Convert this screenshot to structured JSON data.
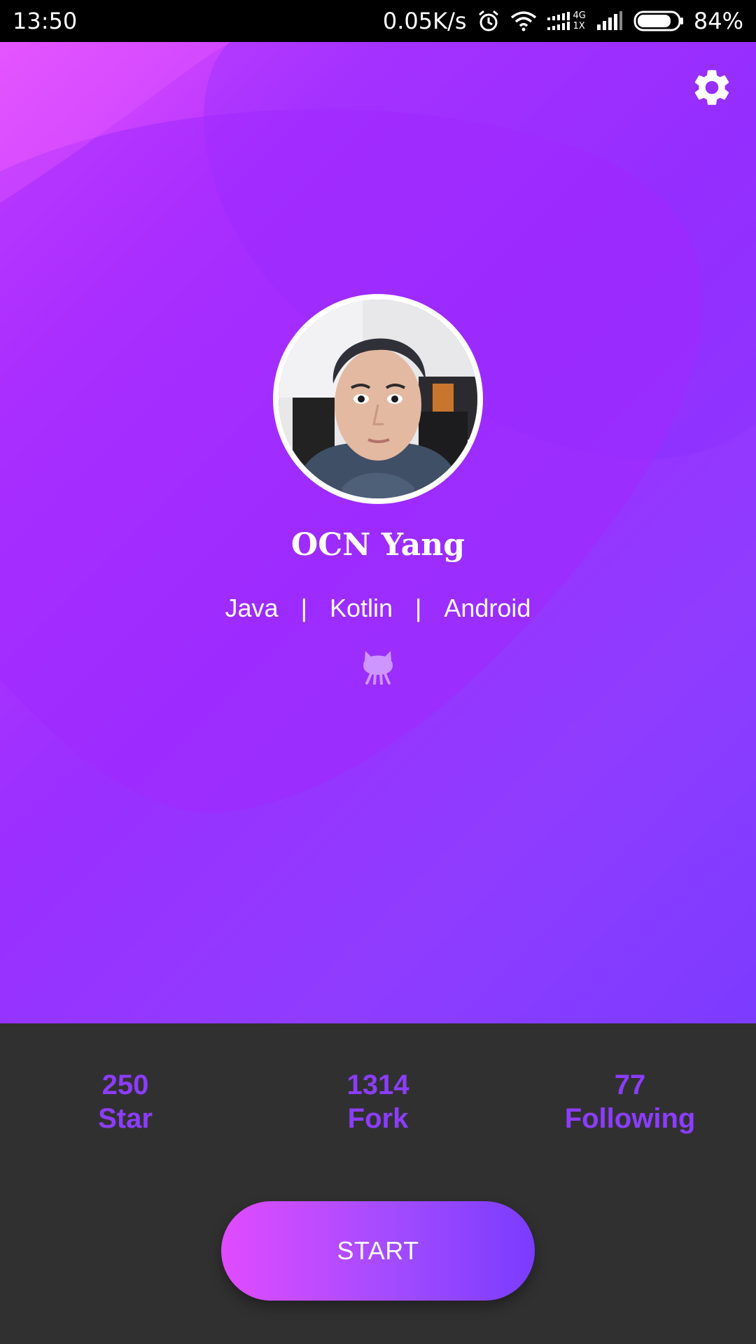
{
  "status_bar": {
    "time": "13:50",
    "network_speed": "0.05K/s",
    "network_type_top": "4G",
    "network_type_bottom": "1X",
    "battery_percent": "84%",
    "battery_level": 0.84,
    "icons": [
      "alarm-icon",
      "wifi-icon",
      "data-signal-icon",
      "cell-signal-icon",
      "battery-icon"
    ]
  },
  "header": {
    "settings_icon": "gear-icon"
  },
  "profile": {
    "name": "OCN Yang",
    "tags": [
      "Java",
      "|",
      "Kotlin",
      "|",
      "Android"
    ],
    "link_icon": "github-icon"
  },
  "stats": [
    {
      "value": "250",
      "label": "Star"
    },
    {
      "value": "1314",
      "label": "Fork"
    },
    {
      "value": "77",
      "label": "Following"
    }
  ],
  "actions": {
    "start_label": "START"
  },
  "colors": {
    "accent": "#8b3dfa",
    "hero_gradient_start": "#e451ff",
    "hero_gradient_end": "#7c3bff",
    "bottom_background": "#313031"
  }
}
